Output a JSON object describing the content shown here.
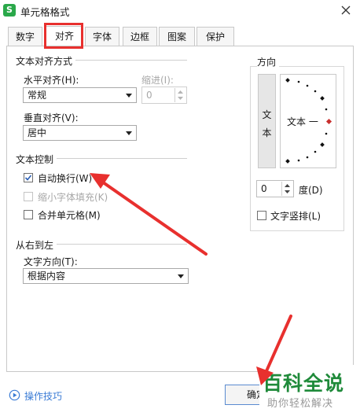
{
  "window": {
    "app_icon_letter": "S",
    "title": "单元格格式",
    "close_glyph": "✕"
  },
  "tabs": [
    {
      "label": "数字"
    },
    {
      "label": "对齐",
      "active": true
    },
    {
      "label": "字体"
    },
    {
      "label": "边框"
    },
    {
      "label": "图案"
    },
    {
      "label": "保护"
    }
  ],
  "text_alignment": {
    "group_title": "文本对齐方式",
    "horizontal": {
      "label": "水平对齐(H):",
      "value": "常规"
    },
    "indent": {
      "label": "缩进(I):",
      "value": "0"
    },
    "vertical": {
      "label": "垂直对齐(V):",
      "value": "居中"
    }
  },
  "text_control": {
    "group_title": "文本控制",
    "wrap_text": {
      "label": "自动换行(W)",
      "checked": true
    },
    "shrink_to_fit": {
      "label": "缩小字体填充(K)",
      "checked": false,
      "disabled": true
    },
    "merge_cells": {
      "label": "合并单元格(M)",
      "checked": false
    }
  },
  "rtl": {
    "group_title": "从右到左",
    "direction_label": "文字方向(T):",
    "direction_value": "根据内容"
  },
  "orientation": {
    "group_title": "方向",
    "vertical_text": [
      "文",
      "本"
    ],
    "dial_text": "文本 一",
    "degrees_value": "0",
    "degrees_label": "度(D)",
    "vertical_arrangement_label": "文字竖排(L)"
  },
  "footer": {
    "tips_label": "操作技巧",
    "ok_label": "确定"
  },
  "watermark": {
    "title": "百科全说",
    "subtitle": "助你轻松解决"
  },
  "colors": {
    "annotation_red": "#e8302e",
    "app_green": "#2aa84a",
    "watermark_green": "#1f8a3a"
  }
}
